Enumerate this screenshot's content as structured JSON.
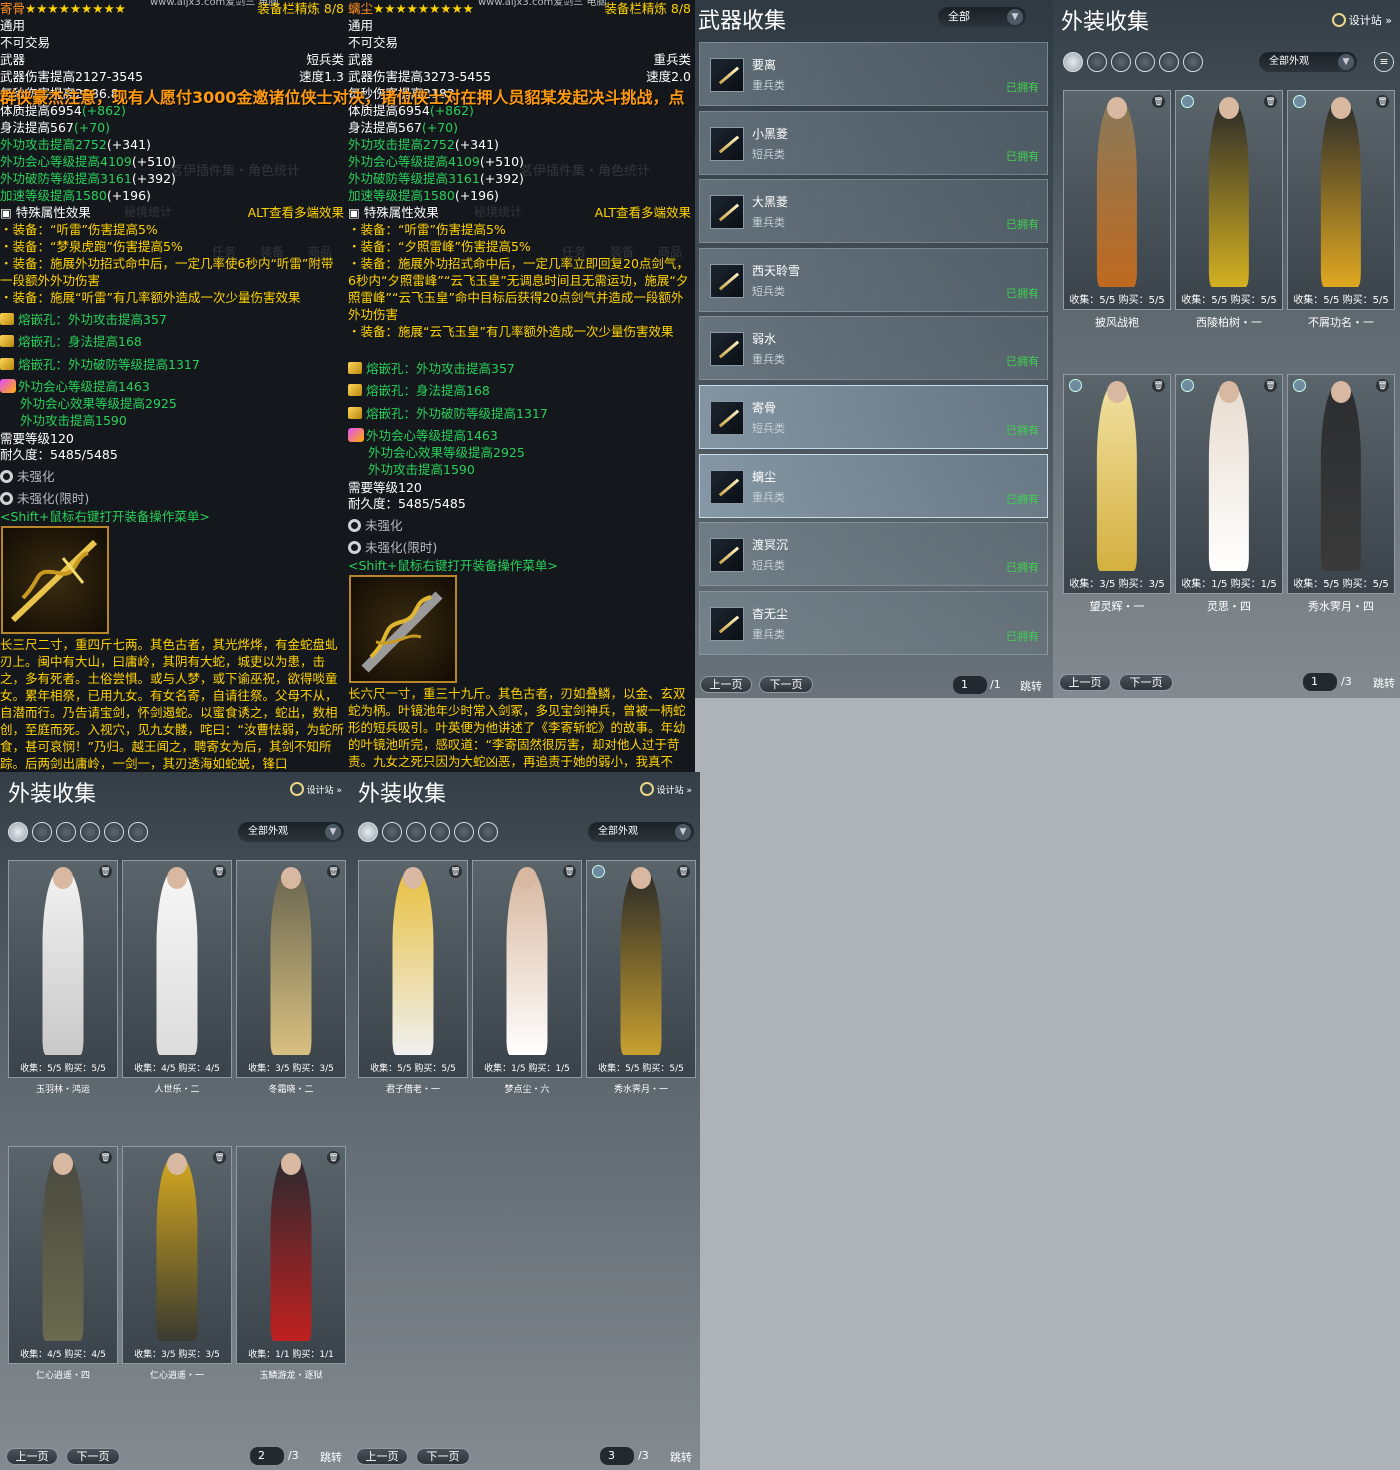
{
  "tip1": {
    "name": "寄骨",
    "stars": "★★★★★★★★★",
    "watermark": "www.aijx3.com爱剑三 电脑",
    "refine": "装备栏精炼 8/8",
    "l1": "通用",
    "l2": "不可交易",
    "l3a": "武器",
    "l3b": "短兵类",
    "l4a": "武器伤害提高2127-3545",
    "l4b": "速度1.3",
    "l5": "每秒伤害提高2186.8",
    "l6": "体质提高6954",
    "l6b": "(+862)",
    "l7": "身法提高567",
    "l7b": "(+70)",
    "l8": "外功攻击提高2752",
    "l8b": "(+341)",
    "l9": "外功会心等级提高4109",
    "l9b": "(+510)",
    "l10": "外功破防等级提高3161",
    "l10b": "(+392)",
    "l11": "加速等级提高1580",
    "l11b": "(+196)",
    "l12": "特殊属性效果",
    "l12b": "ALT查看多端效果",
    "e1": "・装备：“听雷”伤害提高5%",
    "e2": "・装备：“梦泉虎跑”伤害提高5%",
    "e3": "・装备：施展外功招式命中后，一定几率使6秒内“听雷”附带一段额外外功伤害",
    "e4": "・装备：施展“听雷”有几率额外造成一次少量伤害效果",
    "s1": "熔嵌孔：外功攻击提高357",
    "s2": "熔嵌孔：身法提高168",
    "s3": "熔嵌孔：外功破防等级提高1317",
    "s4": "外功会心等级提高1463",
    "s5": "外功会心效果等级提高2925",
    "s6": "外功攻击提高1590",
    "req": "需要等级120",
    "dur": "耐久度：5485/5485",
    "st1": "未强化",
    "st2": "未强化(限时)",
    "shift": "<Shift+鼠标右键打开装备操作菜单>",
    "desc": "长三尺二寸，重四斤七两。其色古者，其光烨烨，有金蛇盘虬刃上。闽中有大山，曰庸岭，其阴有大蛇，城吏以为患，击之，多有死者。土俗尝惧。或与人梦，或下谕巫祝，欲得啖童女。累年相祭，已用九女。有女名寄，自请往祭。父母不从，自潜而行。乃告请宝剑，怀剑遏蛇。以蜜食诱之，蛇出，数相创，至庭而死。入视穴，见九女髅，咤曰：“汝曹怯弱，为蛇所食，甚可哀悯！”乃归。越王闻之，聘寄女为后，其剑不知所踪。后两剑出庸岭，一剑一，其刃透海如蛇蜕，锋口"
  },
  "tip2": {
    "name": "螭尘",
    "stars": "★★★★★★★★★",
    "watermark": "www.aijx3.com爱剑三 电脑",
    "refine": "装备栏精炼 8/8",
    "l1": "通用",
    "l2": "不可交易",
    "l3a": "武器",
    "l3b": "重兵类",
    "l4a": "武器伤害提高3273-5455",
    "l4b": "速度2.0",
    "l5": "每秒伤害提高2182",
    "l6": "体质提高6954",
    "l6b": "(+862)",
    "l7": "身法提高567",
    "l7b": "(+70)",
    "l8": "外功攻击提高2752",
    "l8b": "(+341)",
    "l9": "外功会心等级提高4109",
    "l9b": "(+510)",
    "l10": "外功破防等级提高3161",
    "l10b": "(+392)",
    "l11": "加速等级提高1580",
    "l11b": "(+196)",
    "l12": "特殊属性效果",
    "l12b": "ALT查看多端效果",
    "e1": "・装备：“听雷”伤害提高5%",
    "e2": "・装备：“夕照雷峰”伤害提高5%",
    "e3": "・装备：施展外功招式命中后，一定几率立即回复20点剑气，6秒内“夕照雷峰”“云飞玉皇”无调息时间且无需运功，施展“夕照雷峰”“云飞玉皇”命中目标后获得20点剑气并造成一段额外外功伤害",
    "e4": "・装备：施展“云飞玉皇”有几率额外造成一次少量伤害效果",
    "s1": "熔嵌孔：外功攻击提高357",
    "s2": "熔嵌孔：身法提高168",
    "s3": "熔嵌孔：外功破防等级提高1317",
    "s4": "外功会心等级提高1463",
    "s5": "外功会心效果等级提高2925",
    "s6": "外功攻击提高1590",
    "req": "需要等级120",
    "dur": "耐久度：5485/5485",
    "st1": "未强化",
    "st2": "未强化(限时)",
    "shift": "<Shift+鼠标右键打开装备操作菜单>",
    "desc": "长六尺一寸，重三十九斤。其色古者，刃如叠鳞，以金、玄双蛇为柄。叶镜池年少时常入剑冢，多见宝剑神兵，曾被一柄蛇形的短兵吸引。叶英便为他讲述了《李寄斩蛇》的故事。年幼的叶镜池听完，感叹道：“李寄固然很厉害，却对他人过于苛责。九女之死只因为大蛇凶恶，再追责于她的弱小，我真不"
  },
  "banner": "群侠豪杰注意，现有人愿付3000金邀诸位侠士对决，诸位侠士对在押人员貂某发起决斗挑战，点",
  "ghost": [
    "茗伊插件集・角色统计",
    "秘境统计",
    "任务",
    "装备",
    "商品"
  ],
  "weapons": {
    "title": "武器收集",
    "filter": "全部",
    "rows": [
      {
        "name": "要离",
        "type": "重兵类",
        "own": "已拥有"
      },
      {
        "name": "小黑菱",
        "type": "短兵类",
        "own": "已拥有"
      },
      {
        "name": "大黑菱",
        "type": "重兵类",
        "own": "已拥有"
      },
      {
        "name": "西天聆雪",
        "type": "短兵类",
        "own": "已拥有"
      },
      {
        "name": "弱水",
        "type": "重兵类",
        "own": "已拥有"
      },
      {
        "name": "寄骨",
        "type": "短兵类",
        "own": "已拥有"
      },
      {
        "name": "螭尘",
        "type": "重兵类",
        "own": "已拥有"
      },
      {
        "name": "渡冥沉",
        "type": "短兵类",
        "own": "已拥有"
      },
      {
        "name": "杳无尘",
        "type": "重兵类",
        "own": "已拥有"
      }
    ],
    "prev": "上一页",
    "next": "下一页",
    "page": "1",
    "total": "/1",
    "jump": "跳转"
  },
  "c1": {
    "title": "外装收集",
    "design": "设计站",
    "filter": "全部外观",
    "page": "1",
    "total": "/3",
    "prev": "上一页",
    "next": "下一页",
    "jump": "跳转",
    "cards": [
      {
        "cnt": "收集：5/5  购买：5/5",
        "name": "披风战袍",
        "c1": "#8a7a5a",
        "c2": "#c06a20"
      },
      {
        "cnt": "收集：5/5  购买：5/5",
        "name": "西陵柏树・一",
        "c1": "#2a2a2a",
        "c2": "#d4b020"
      },
      {
        "cnt": "收集：5/5  购买：5/5",
        "name": "不屑功名・一",
        "c1": "#2b2b2b",
        "c2": "#e0a820"
      },
      {
        "cnt": "收集：3/5  购买：3/5",
        "name": "望灵辉・一",
        "c1": "#f0e0a0",
        "c2": "#d4b040"
      },
      {
        "cnt": "收集：1/5  购买：1/5",
        "name": "灵思・四",
        "c1": "#e8dcd0",
        "c2": "#ffffff"
      },
      {
        "cnt": "收集：5/5  购买：5/5",
        "name": "秀水霁月・四",
        "c1": "#2b2d30",
        "c2": "#3a3a3a"
      }
    ]
  },
  "c2": {
    "title": "外装收集",
    "design": "设计站",
    "filter": "全部外观",
    "page": "2",
    "total": "/3",
    "prev": "上一页",
    "next": "下一页",
    "jump": "跳转",
    "cards": [
      {
        "cnt": "收集：5/5    购买：5/5",
        "name": "玉羽林・鸿运",
        "c1": "#f2f2f2",
        "c2": "#c8c8c8"
      },
      {
        "cnt": "收集：4/5    购买：4/5",
        "name": "人世乐・二",
        "c1": "#f6f6f6",
        "c2": "#dcdcdc"
      },
      {
        "cnt": "收集：3/5    购买：3/5",
        "name": "冬霜晓・二",
        "c1": "#6a6650",
        "c2": "#d8c080"
      },
      {
        "cnt": "收集：4/5    购买：4/5",
        "name": "仁心逍遥・四",
        "c1": "#4a4a40",
        "c2": "#6a6a50"
      },
      {
        "cnt": "收集：3/5    购买：3/5",
        "name": "仁心逍遥・一",
        "c1": "#d4a820",
        "c2": "#3a3a30"
      },
      {
        "cnt": "收集：1/1    购买：1/1",
        "name": "玉鳞游龙・逐狱",
        "c1": "#2a2a30",
        "c2": "#c02020"
      }
    ]
  },
  "c3": {
    "title": "外装收集",
    "design": "设计站",
    "filter": "全部外观",
    "page": "3",
    "total": "/3",
    "prev": "上一页",
    "next": "下一页",
    "jump": "跳转",
    "cards": [
      {
        "cnt": "收集：5/5    购买：5/5",
        "name": "君子借老・一",
        "c1": "#e8c040",
        "c2": "#f0f0f0"
      },
      {
        "cnt": "收集：1/5    购买：1/5",
        "name": "梦点尘・六",
        "c1": "#d8b8a0",
        "c2": "#ffffff"
      },
      {
        "cnt": "收集：5/5  购买：5/5",
        "name": "秀水霁月・一",
        "c1": "#2a2a28",
        "c2": "#c8a030"
      }
    ]
  }
}
